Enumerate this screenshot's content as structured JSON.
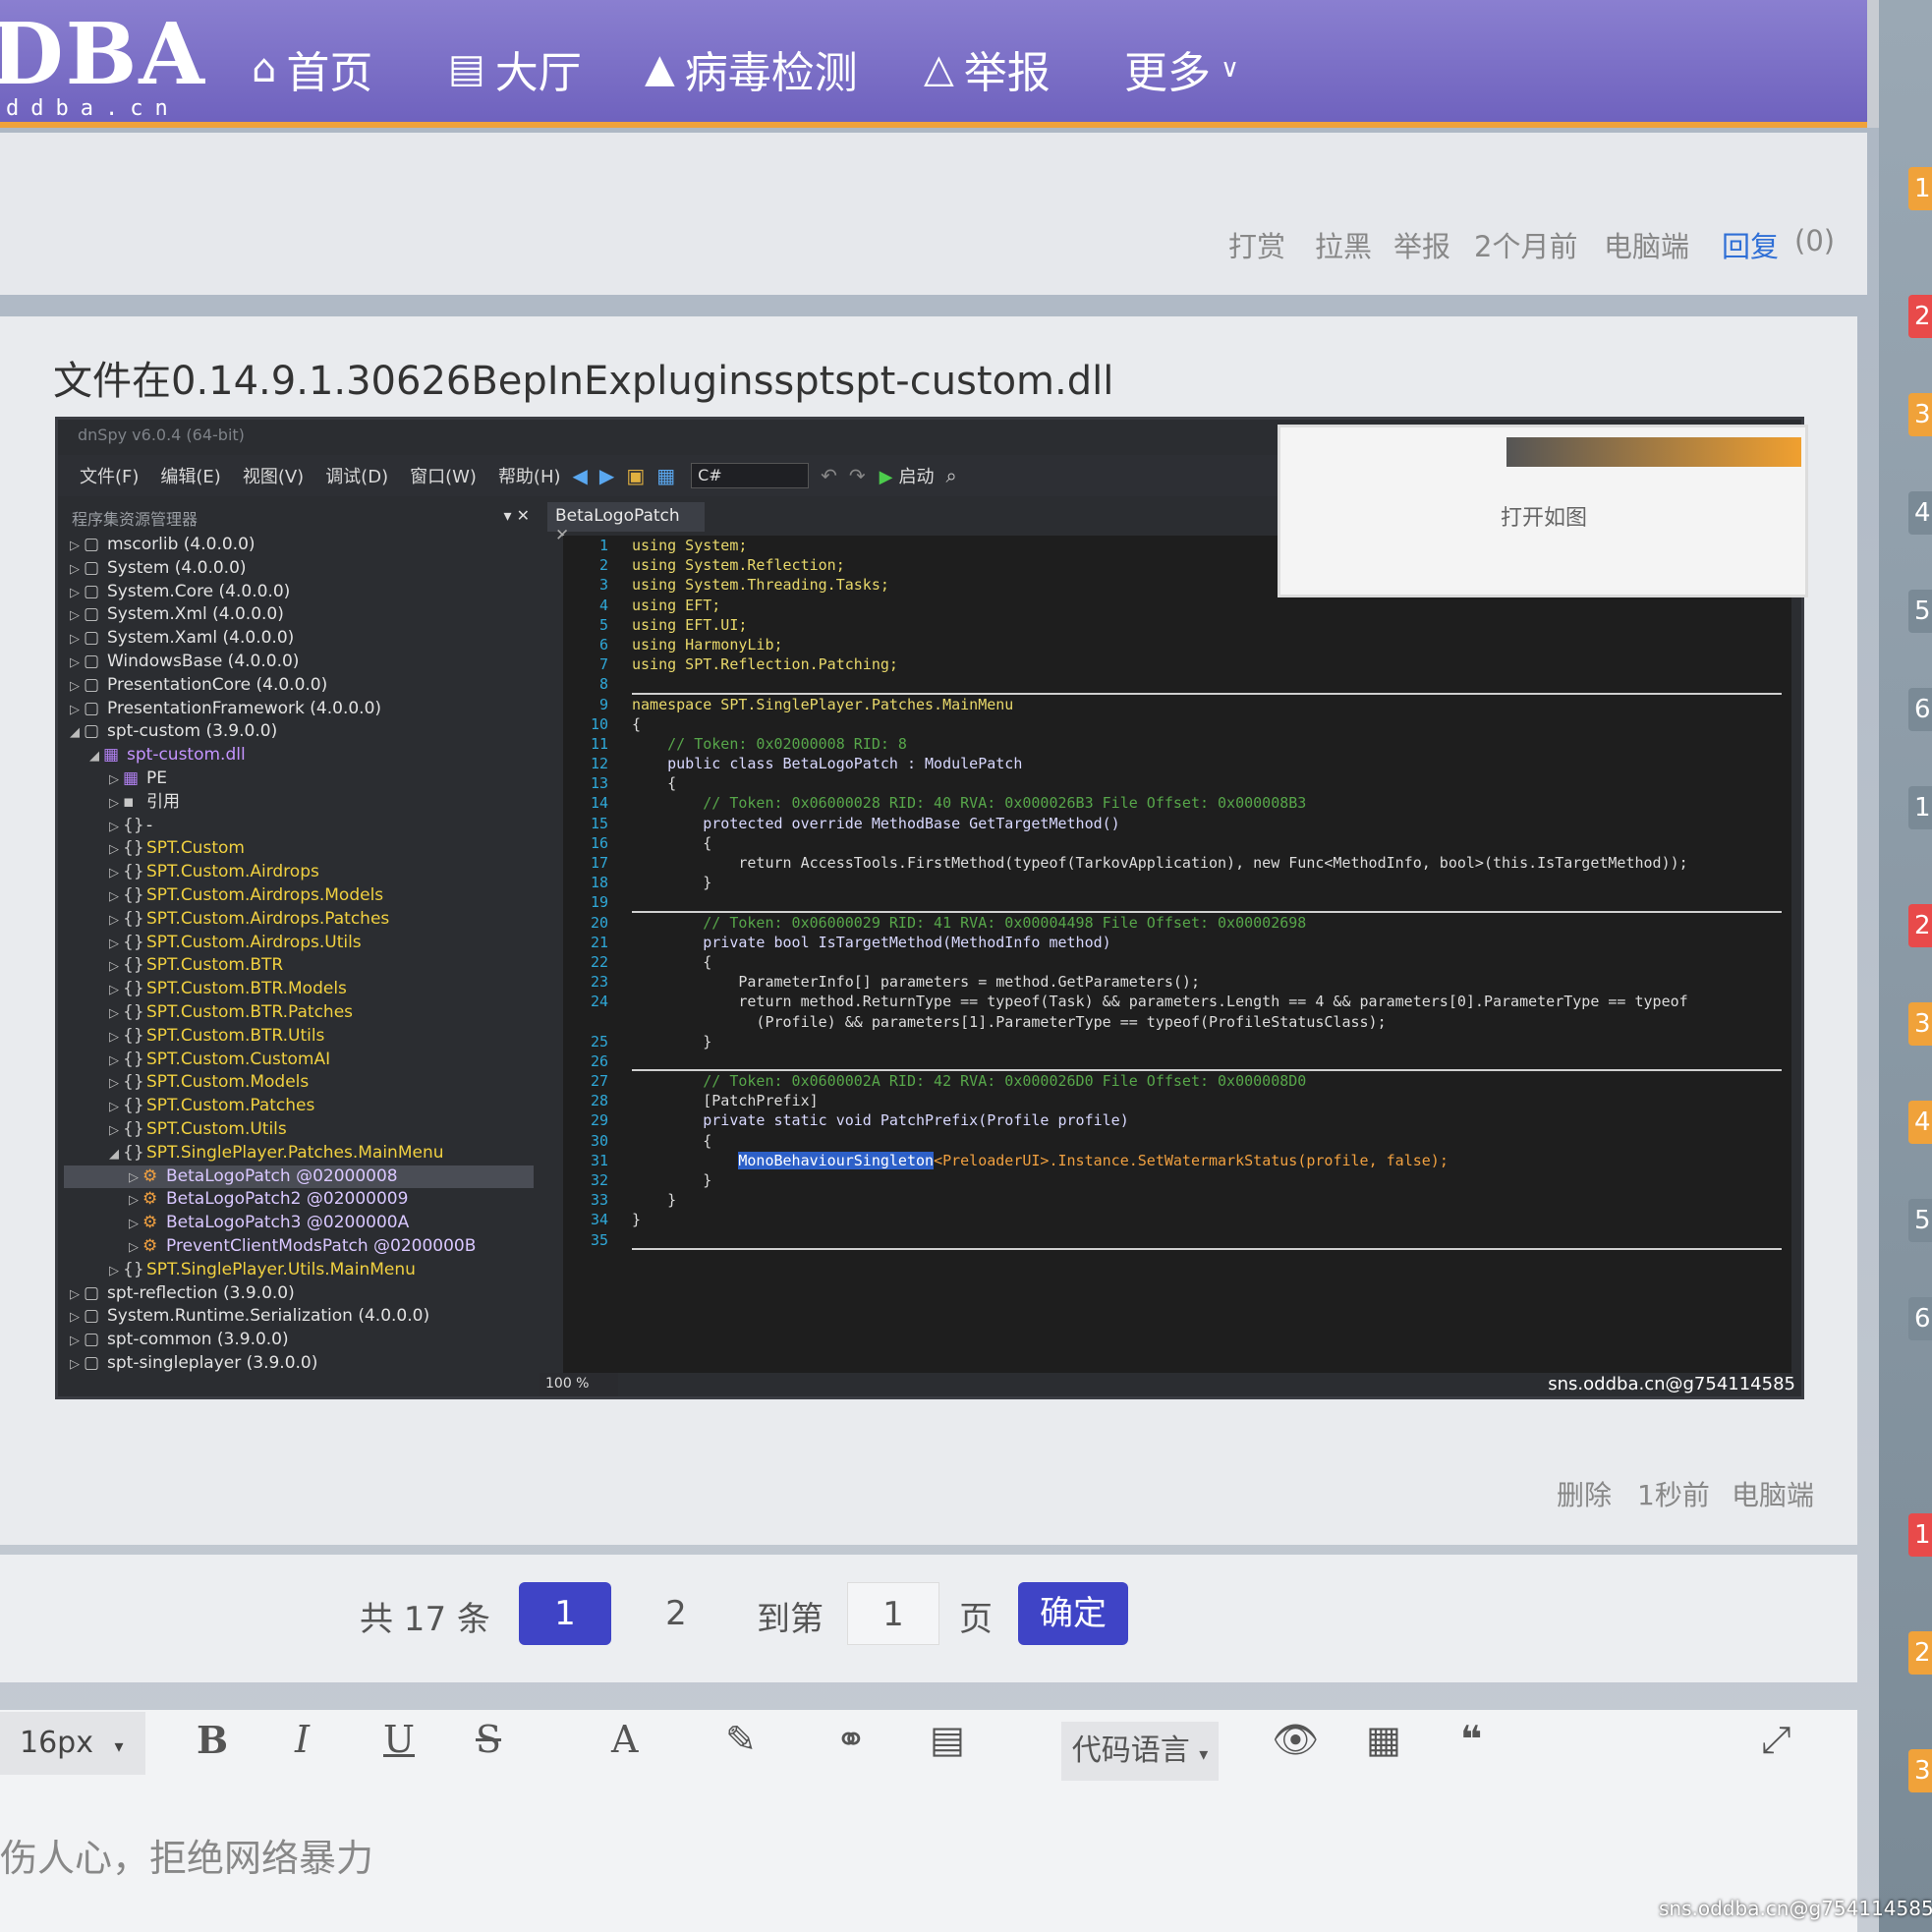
{
  "logo": {
    "big": "DBA",
    "small": "ddba.cn"
  },
  "nav": [
    {
      "label": "首页",
      "icon": "home-icon"
    },
    {
      "label": "大厅",
      "icon": "book-icon"
    },
    {
      "label": "病毒检测",
      "icon": "warning-icon"
    },
    {
      "label": "举报",
      "icon": "warning-outline-icon"
    },
    {
      "label": "更多",
      "icon": "chevron-down-icon"
    }
  ],
  "post1_meta": {
    "tip": "打赏",
    "block": "拉黑",
    "report": "举报",
    "time": "2个月前",
    "device": "电脑端",
    "reply": "回复",
    "reply_count": "(0)"
  },
  "post2": {
    "title": "文件在0.14.9.1.30626BepInExpluginssptspt-custom.dll",
    "meta": {
      "delete": "删除",
      "time": "1秒前",
      "device": "电脑端"
    }
  },
  "dnspy": {
    "window_title": "dnSpy v6.0.4 (64-bit)",
    "menus": [
      "文件(F)",
      "编辑(E)",
      "视图(V)",
      "调试(D)",
      "窗口(W)",
      "帮助(H)"
    ],
    "language": "C#",
    "start_label": "启动",
    "tree_header": "程序集资源管理器",
    "editor_tab": "BetaLogoPatch",
    "zoom": "100 %",
    "tree": [
      {
        "label": "mscorlib (4.0.0.0)",
        "level": 0,
        "kind": "asm"
      },
      {
        "label": "System (4.0.0.0)",
        "level": 0,
        "kind": "asm"
      },
      {
        "label": "System.Core (4.0.0.0)",
        "level": 0,
        "kind": "asm"
      },
      {
        "label": "System.Xml (4.0.0.0)",
        "level": 0,
        "kind": "asm"
      },
      {
        "label": "System.Xaml (4.0.0.0)",
        "level": 0,
        "kind": "asm"
      },
      {
        "label": "WindowsBase (4.0.0.0)",
        "level": 0,
        "kind": "asm"
      },
      {
        "label": "PresentationCore (4.0.0.0)",
        "level": 0,
        "kind": "asm"
      },
      {
        "label": "PresentationFramework (4.0.0.0)",
        "level": 0,
        "kind": "asm"
      },
      {
        "label": "spt-custom (3.9.0.0)",
        "level": 0,
        "kind": "asm-open"
      },
      {
        "label": "spt-custom.dll",
        "level": 1,
        "kind": "dll"
      },
      {
        "label": "PE",
        "level": 2,
        "kind": "pe"
      },
      {
        "label": "引用",
        "level": 2,
        "kind": "ref"
      },
      {
        "label": "-",
        "level": 2,
        "kind": "ns-plain"
      },
      {
        "label": "SPT.Custom",
        "level": 2,
        "kind": "ns"
      },
      {
        "label": "SPT.Custom.Airdrops",
        "level": 2,
        "kind": "ns"
      },
      {
        "label": "SPT.Custom.Airdrops.Models",
        "level": 2,
        "kind": "ns"
      },
      {
        "label": "SPT.Custom.Airdrops.Patches",
        "level": 2,
        "kind": "ns"
      },
      {
        "label": "SPT.Custom.Airdrops.Utils",
        "level": 2,
        "kind": "ns"
      },
      {
        "label": "SPT.Custom.BTR",
        "level": 2,
        "kind": "ns"
      },
      {
        "label": "SPT.Custom.BTR.Models",
        "level": 2,
        "kind": "ns"
      },
      {
        "label": "SPT.Custom.BTR.Patches",
        "level": 2,
        "kind": "ns"
      },
      {
        "label": "SPT.Custom.BTR.Utils",
        "level": 2,
        "kind": "ns"
      },
      {
        "label": "SPT.Custom.CustomAI",
        "level": 2,
        "kind": "ns"
      },
      {
        "label": "SPT.Custom.Models",
        "level": 2,
        "kind": "ns"
      },
      {
        "label": "SPT.Custom.Patches",
        "level": 2,
        "kind": "ns"
      },
      {
        "label": "SPT.Custom.Utils",
        "level": 2,
        "kind": "ns"
      },
      {
        "label": "SPT.SinglePlayer.Patches.MainMenu",
        "level": 2,
        "kind": "ns-open"
      },
      {
        "label": "BetaLogoPatch @02000008",
        "level": 3,
        "kind": "cls-sel"
      },
      {
        "label": "BetaLogoPatch2 @02000009",
        "level": 3,
        "kind": "cls"
      },
      {
        "label": "BetaLogoPatch3 @0200000A",
        "level": 3,
        "kind": "cls"
      },
      {
        "label": "PreventClientModsPatch @0200000B",
        "level": 3,
        "kind": "cls"
      },
      {
        "label": "SPT.SinglePlayer.Utils.MainMenu",
        "level": 2,
        "kind": "ns"
      },
      {
        "label": "spt-reflection (3.9.0.0)",
        "level": 0,
        "kind": "asm"
      },
      {
        "label": "System.Runtime.Serialization (4.0.0.0)",
        "level": 0,
        "kind": "asm"
      },
      {
        "label": "spt-common (3.9.0.0)",
        "level": 0,
        "kind": "asm"
      },
      {
        "label": "spt-singleplayer (3.9.0.0)",
        "level": 0,
        "kind": "asm"
      }
    ],
    "code": [
      "using System;",
      "using System.Reflection;",
      "using System.Threading.Tasks;",
      "using EFT;",
      "using EFT.UI;",
      "using HarmonyLib;",
      "using SPT.Reflection.Patching;",
      "",
      "namespace SPT.SinglePlayer.Patches.MainMenu",
      "{",
      "    // Token: 0x02000008 RID: 8",
      "    public class BetaLogoPatch : ModulePatch",
      "    {",
      "        // Token: 0x06000028 RID: 40 RVA: 0x000026B3 File Offset: 0x000008B3",
      "        protected override MethodBase GetTargetMethod()",
      "        {",
      "            return AccessTools.FirstMethod(typeof(TarkovApplication), new Func<MethodInfo, bool>(this.IsTargetMethod));",
      "        }",
      "",
      "        // Token: 0x06000029 RID: 41 RVA: 0x00004498 File Offset: 0x00002698",
      "        private bool IsTargetMethod(MethodInfo method)",
      "        {",
      "            ParameterInfo[] parameters = method.GetParameters();",
      "            return method.ReturnType == typeof(Task) && parameters.Length == 4 && parameters[0].ParameterType == typeof",
      "              (Profile) && parameters[1].ParameterType == typeof(ProfileStatusClass);",
      "        }",
      "",
      "        // Token: 0x0600002A RID: 42 RVA: 0x000026D0 File Offset: 0x000008D0",
      "        [PatchPrefix]",
      "        private static void PatchPrefix(Profile profile)",
      "        {",
      "            MonoBehaviourSingleton<PreloaderUI>.Instance.SetWatermarkStatus(profile, false);",
      "        }",
      "    }",
      "}",
      ""
    ],
    "line_numbers": [
      "1",
      "2",
      "3",
      "4",
      "5",
      "6",
      "7",
      "8",
      "9",
      "10",
      "11",
      "12",
      "13",
      "14",
      "15",
      "16",
      "17",
      "18",
      "19",
      "20",
      "21",
      "22",
      "23",
      "24",
      "",
      "25",
      "26",
      "27",
      "28",
      "29",
      "30",
      "31",
      "32",
      "33",
      "34",
      "35"
    ],
    "watermark": "sns.oddba.cn@g754114585"
  },
  "popup": {
    "label": "打开如图"
  },
  "pager": {
    "total": "共 17 条",
    "page1": "1",
    "page2": "2",
    "goto": "到第",
    "page_input": "1",
    "page_unit": "页",
    "confirm": "确定"
  },
  "editor": {
    "font_size": "16px",
    "code_lang": "代码语言",
    "placeholder": "伤人心，拒绝网络暴力",
    "tools": [
      "B",
      "I",
      "U",
      "S",
      "A",
      "✎",
      "⚭",
      "▤",
      "👁",
      "▦",
      "❝",
      "⤢"
    ]
  },
  "right_badges": [
    "1",
    "2",
    "3",
    "4",
    "5",
    "6",
    "1",
    "2",
    "3",
    "4",
    "5",
    "6",
    "1",
    "2",
    "3"
  ],
  "colors": {
    "nav_bg": "#7469c4",
    "accent": "#3f44c6",
    "orange": "#f0a23a",
    "red": "#e84a4a"
  },
  "watermark": "sns.oddba.cn@g754114585"
}
